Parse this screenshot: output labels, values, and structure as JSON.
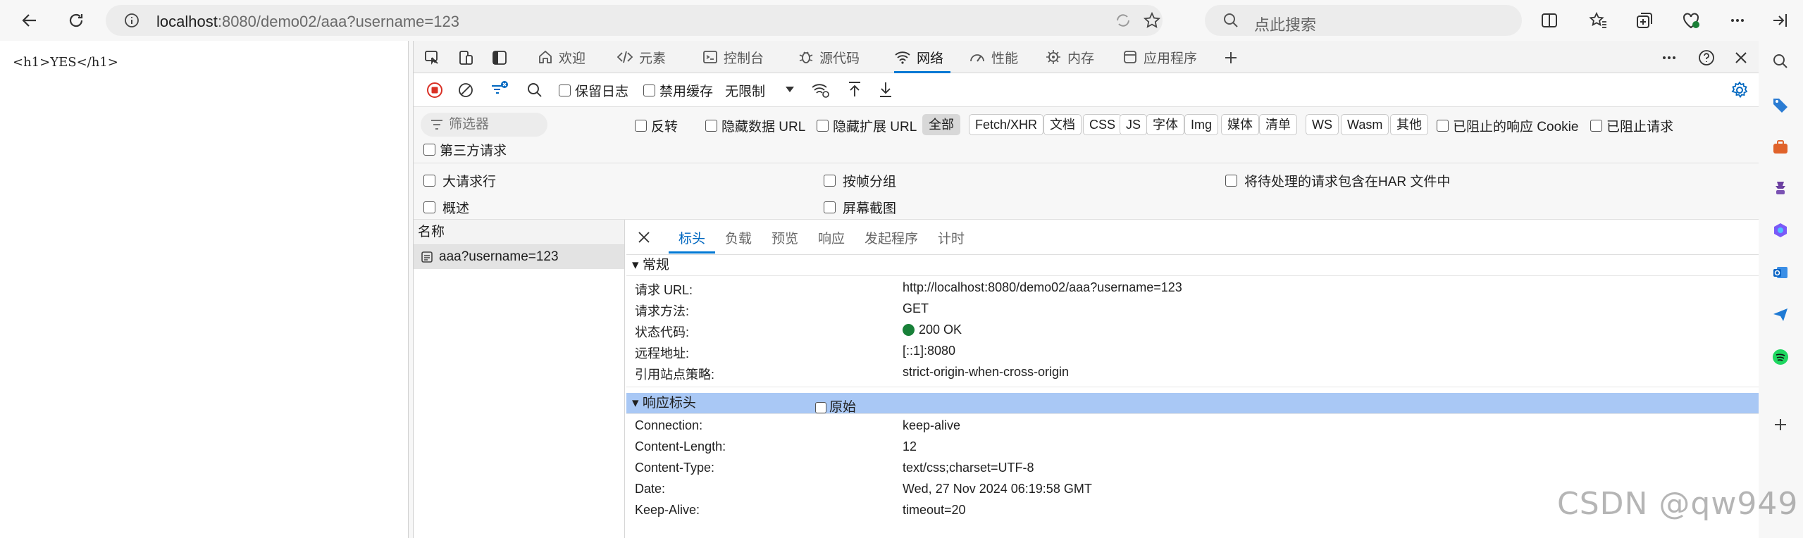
{
  "browser": {
    "url_host": "localhost",
    "url_rest": ":8080/demo02/aaa?username=123",
    "search_placeholder": "点此搜索"
  },
  "page": {
    "content": "<h1>YES</h1>"
  },
  "devtools": {
    "tabs": [
      {
        "label": "欢迎",
        "icon": "home-icon"
      },
      {
        "label": "元素",
        "icon": "code-icon"
      },
      {
        "label": "控制台",
        "icon": "console-icon"
      },
      {
        "label": "源代码",
        "icon": "bug-icon"
      },
      {
        "label": "网络",
        "icon": "wifi-icon",
        "active": true
      },
      {
        "label": "性能",
        "icon": "performance-icon"
      },
      {
        "label": "内存",
        "icon": "memory-icon"
      },
      {
        "label": "应用程序",
        "icon": "application-icon"
      }
    ],
    "toolbar": {
      "preserve_log": "保留日志",
      "disable_cache": "禁用缓存",
      "throttling": "无限制"
    },
    "filter": {
      "placeholder": "筛选器",
      "invert": "反转",
      "hide_data_url": "隐藏数据 URL",
      "hide_ext_url": "隐藏扩展 URL",
      "chips": [
        "全部",
        "Fetch/XHR",
        "文档",
        "CSS",
        "JS",
        "字体",
        "Img",
        "媒体",
        "清单",
        "WS",
        "Wasm",
        "其他"
      ],
      "blocked_cookies": "已阻止的响应 Cookie",
      "blocked_requests": "已阻止请求",
      "third_party": "第三方请求"
    },
    "options": {
      "big_rows": "大请求行",
      "group_by_frame": "按帧分组",
      "har_pending": "将待处理的请求包含在HAR 文件中",
      "overview": "概述",
      "screenshots": "屏幕截图"
    },
    "request_list": {
      "header": "名称",
      "items": [
        "aaa?username=123"
      ]
    },
    "detail": {
      "tabs": [
        "标头",
        "负载",
        "预览",
        "响应",
        "发起程序",
        "计时"
      ],
      "general_title": "常规",
      "general": [
        {
          "k": "请求 URL:",
          "v": "http://localhost:8080/demo02/aaa?username=123"
        },
        {
          "k": "请求方法:",
          "v": "GET"
        },
        {
          "k": "状态代码:",
          "v": "200 OK"
        },
        {
          "k": "远程地址:",
          "v": "[::1]:8080"
        },
        {
          "k": "引用站点策略:",
          "v": "strict-origin-when-cross-origin"
        }
      ],
      "response_title": "响应标头",
      "raw_label": "原始",
      "response": [
        {
          "k": "Connection:",
          "v": "keep-alive"
        },
        {
          "k": "Content-Length:",
          "v": "12"
        },
        {
          "k": "Content-Type:",
          "v": "text/css;charset=UTF-8"
        },
        {
          "k": "Date:",
          "v": "Wed, 27 Nov 2024 06:19:58 GMT"
        },
        {
          "k": "Keep-Alive:",
          "v": "timeout=20"
        }
      ]
    }
  },
  "watermark": "CSDN @qw949"
}
